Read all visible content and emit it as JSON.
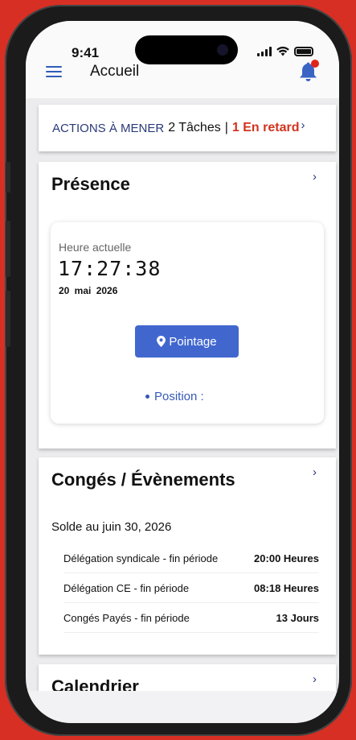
{
  "status_bar": {
    "time": "9:41"
  },
  "header": {
    "title": "Accueil"
  },
  "actions": {
    "label": "ACTIONS À MENER",
    "tasks": "2 Tâches",
    "separator": "|",
    "late": "1 En retard"
  },
  "presence": {
    "title": "Présence",
    "clock_label": "Heure actuelle",
    "time": "17:27:38",
    "date": "20 mai 2026",
    "button_label": "Pointage",
    "position_label": "Position :"
  },
  "conges": {
    "title": "Congés / Évènements",
    "solde": "Solde au juin 30, 2026",
    "rows": [
      {
        "label": "Délégation syndicale - fin période",
        "value": "20:00 Heures"
      },
      {
        "label": "Délégation CE - fin période",
        "value": "08:18 Heures"
      },
      {
        "label": "Congés Payés - fin période",
        "value": "13 Jours"
      }
    ]
  },
  "calendrier": {
    "title": "Calendrier"
  },
  "colors": {
    "background": "#d82f24",
    "accent": "#4167cf",
    "navy": "#2a3a7a",
    "late": "#d2331f"
  },
  "icons": [
    "menu-icon",
    "bell-icon",
    "chevron-right-icon",
    "map-pin-icon",
    "signal-icon",
    "wifi-icon",
    "battery-icon"
  ]
}
